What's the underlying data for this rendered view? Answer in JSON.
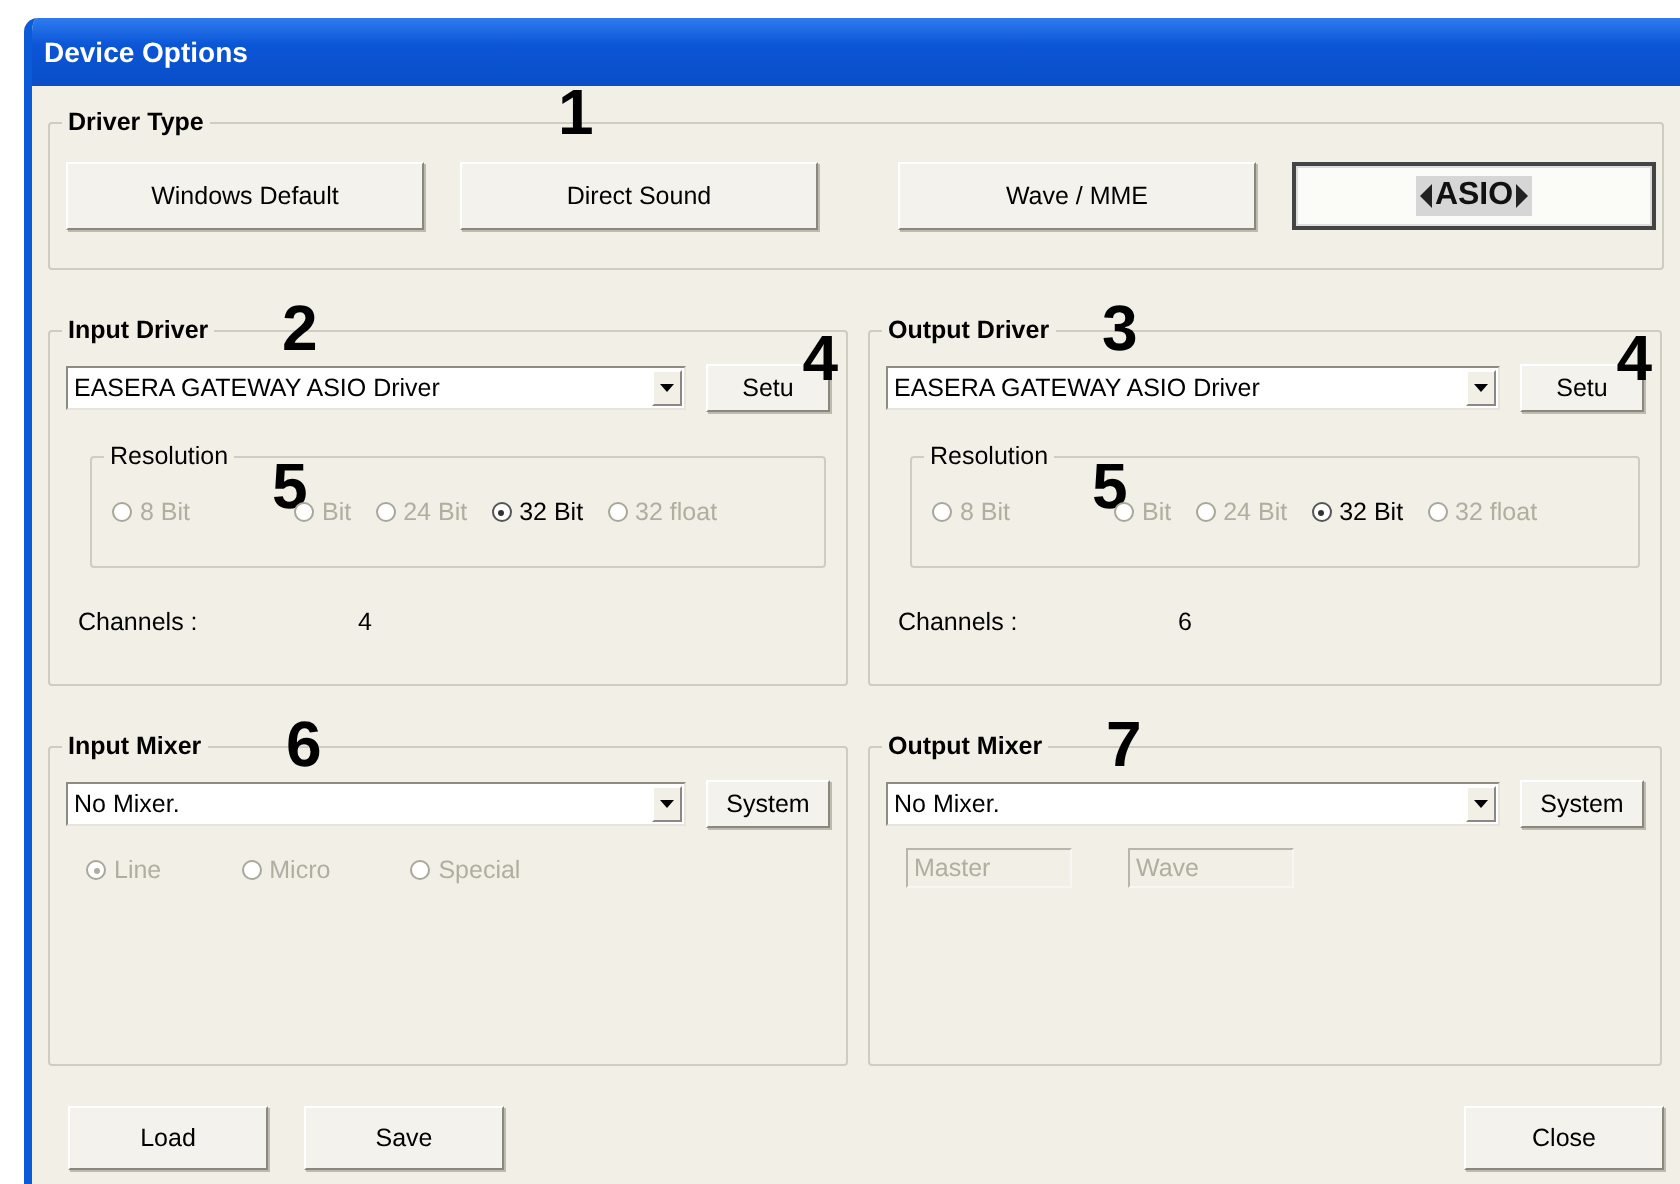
{
  "window": {
    "title": "Device Options"
  },
  "driver_type": {
    "label": "Driver Type",
    "callout": "1",
    "options": [
      {
        "label": "Windows Default",
        "kind": "text",
        "selected": false
      },
      {
        "label": "Direct Sound",
        "kind": "text",
        "selected": false
      },
      {
        "label": "Wave / MME",
        "kind": "text",
        "selected": false
      },
      {
        "label": "ASIO",
        "kind": "logo",
        "selected": true
      }
    ]
  },
  "drivers": [
    {
      "label": "Input Driver",
      "callout": "2",
      "driver": "EASERA GATEWAY ASIO Driver",
      "setup_button": "Setu",
      "setup_callout": "4",
      "resolution": {
        "label": "Resolution",
        "callout": "5",
        "options": [
          {
            "label": "8 Bit",
            "checked": false,
            "disabled": true
          },
          {
            "label": "Bit",
            "checked": false,
            "disabled": true
          },
          {
            "label": "24 Bit",
            "checked": false,
            "disabled": true
          },
          {
            "label": "32 Bit",
            "checked": true,
            "disabled": false
          },
          {
            "label": "32 float",
            "checked": false,
            "disabled": true
          }
        ]
      },
      "channels_label": "Channels :",
      "channels": "4"
    },
    {
      "label": "Output Driver",
      "callout": "3",
      "driver": "EASERA GATEWAY ASIO Driver",
      "setup_button": "Setu",
      "setup_callout": "4",
      "resolution": {
        "label": "Resolution",
        "callout": "5",
        "options": [
          {
            "label": "8 Bit",
            "checked": false,
            "disabled": true
          },
          {
            "label": "Bit",
            "checked": false,
            "disabled": true
          },
          {
            "label": "24 Bit",
            "checked": false,
            "disabled": true
          },
          {
            "label": "32 Bit",
            "checked": true,
            "disabled": false
          },
          {
            "label": "32 float",
            "checked": false,
            "disabled": true
          }
        ]
      },
      "channels_label": "Channels :",
      "channels": "6"
    }
  ],
  "mixers": [
    {
      "label": "Input Mixer",
      "callout": "6",
      "mixer": "No Mixer.",
      "system_button": "System",
      "kind": "sources",
      "sources": [
        {
          "label": "Line",
          "checked": true,
          "disabled": true
        },
        {
          "label": "Micro",
          "checked": false,
          "disabled": true
        },
        {
          "label": "Special",
          "checked": false,
          "disabled": true
        }
      ]
    },
    {
      "label": "Output Mixer",
      "callout": "7",
      "mixer": "No Mixer.",
      "system_button": "System",
      "kind": "faders",
      "faders": [
        {
          "value": "Master",
          "disabled": true
        },
        {
          "value": "Wave",
          "disabled": true
        }
      ]
    }
  ],
  "buttons_left": [
    {
      "label": "Load"
    },
    {
      "label": "Save"
    }
  ],
  "buttons_right": [
    {
      "label": "Close"
    }
  ]
}
